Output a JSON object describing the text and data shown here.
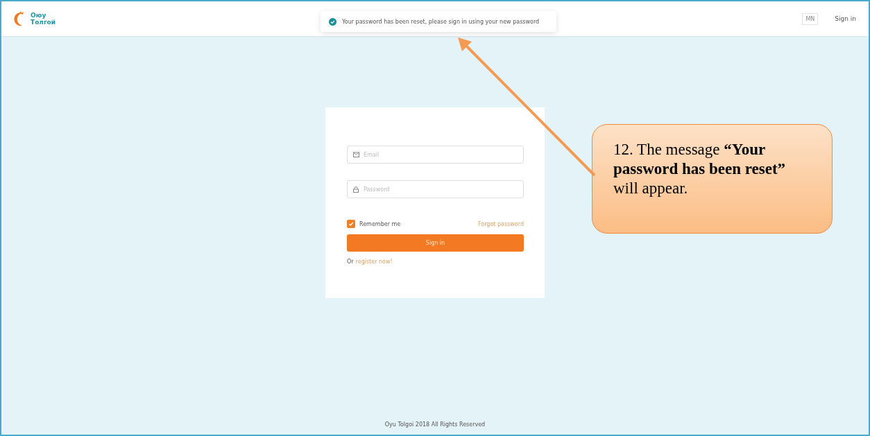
{
  "header": {
    "logo_lines": [
      "Оюу",
      "Толгой"
    ],
    "toast": "Your password has been reset, please sign in using your new password",
    "language": "MN",
    "sign_in": "Sign in"
  },
  "login": {
    "email": {
      "placeholder": "Email"
    },
    "password": {
      "placeholder": "Password"
    },
    "remember": {
      "label": "Remember me",
      "checked": true
    },
    "forgot": "Forgot password",
    "submit": "Sign in",
    "register_prefix": "Or",
    "register_link": "register now!"
  },
  "footer": "Oyu Tolgoi 2018 All Rights Reserved",
  "annotation": {
    "text": "12. The message **“Your password has been reset”** will appear."
  }
}
